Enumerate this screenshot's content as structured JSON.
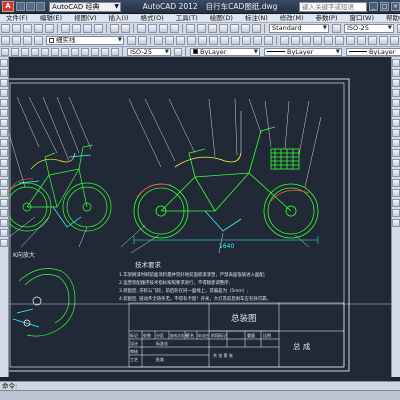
{
  "window": {
    "app_combo": "AutoCAD 经典",
    "app_name": "AutoCAD 2012",
    "file_name": "自行车CAD图纸.dwg",
    "search_placeholder": "键入关键字或短语"
  },
  "menu": [
    "文件(F)",
    "编辑(E)",
    "视图(V)",
    "插入(I)",
    "格式(O)",
    "工具(T)",
    "绘图(D)",
    "标注(N)",
    "修改(M)",
    "参数(P)",
    "窗口(W)",
    "帮助(H)"
  ],
  "toolbar2": {
    "layer_combo": "细实线",
    "style_combo": "Standard",
    "dim_style": "ISO-25",
    "table_style": "Standard"
  },
  "toolbar3": {
    "dim_style": "ISO-25",
    "color": "ByLayer",
    "linetype": "ByLayer",
    "lineweight": "ByLayer"
  },
  "drawing": {
    "dimension": "1640",
    "detail_label": "K向放大",
    "tech_title": "技术要求",
    "tech_lines": [
      "1.车架刷漆时刷前面涂料量并完好地前面喷漆漆塑，严禁表面钣质进入面配;",
      "2.运营装配顺序技术指标按照要求进行，不得随意调整序;",
      "3.装配后, 牙轮与飞轮，前后轮在同一面线上，其偏差为（5mm）;",
      "4.装配后, 链动齐全链条无，不得有卡阻！开关，大灯及前后刹车应有效可靠。"
    ],
    "title_main": "总装图",
    "title_sub": "总  成",
    "tb_row1": [
      "标记",
      "处数",
      "分区",
      "更改文件号",
      "签名",
      "年月日"
    ],
    "tb_design": "设计",
    "tb_std": "标准化",
    "tb_stage": "阶段标记",
    "tb_weight": "重量",
    "tb_scale": "比例",
    "tb_check": "审核",
    "tb_craft": "工艺",
    "tb_approve": "批准",
    "tb_sheet": "共 张 第 张"
  },
  "command_line": "命令:",
  "colors": {
    "canvas_bg": "#212836",
    "frame": "#ffffff",
    "part_green": "#39ff39",
    "accent_yellow": "#ffff33",
    "dim_cyan": "#33ffff"
  }
}
